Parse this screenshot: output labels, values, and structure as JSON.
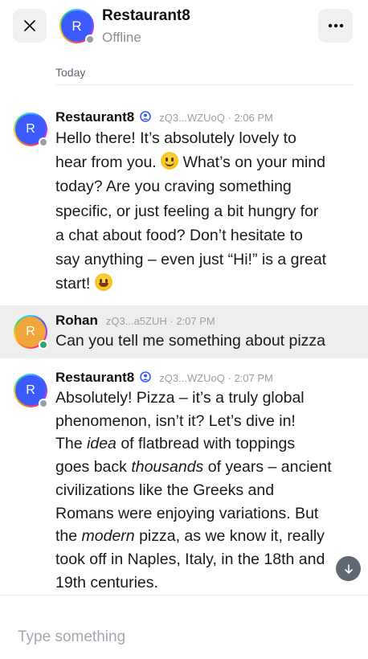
{
  "header": {
    "name": "Restaurant8",
    "status": "Offline",
    "avatar_letter": "R"
  },
  "day_label": "Today",
  "messages": [
    {
      "sender": "Restaurant8",
      "verified": true,
      "address": "zQ3...WZUoQ",
      "time": "2:06 PM",
      "avatar_letter": "R",
      "lines": [
        "Hello there! It’s absolutely lovely to",
        "hear from you.",
        "What’s on your mind",
        "today? Are you craving something",
        "specific, or just feeling a bit hungry for",
        "a chat about food? Don’t hesitate to",
        "say anything – even just “Hi!” is a great",
        "start!"
      ]
    },
    {
      "sender": "Rohan",
      "verified": false,
      "address": "zQ3...a5ZUH",
      "time": "2:07 PM",
      "avatar_letter": "R",
      "lines": [
        "Can you tell me something about pizza"
      ]
    },
    {
      "sender": "Restaurant8",
      "verified": true,
      "address": "zQ3...WZUoQ",
      "time": "2:07 PM",
      "avatar_letter": "R",
      "lines": [
        "Absolutely! Pizza – it’s a truly global",
        "phenomenon, isn’t it? Let’s dive in!",
        "The ",
        "idea",
        " of flatbread with toppings",
        "goes back ",
        "thousands",
        " of years – ancient",
        "civilizations like the Greeks and",
        "Romans were enjoying variations. But",
        "the ",
        "modern",
        " pizza, as we know it, really",
        "took off in Naples, Italy, in the 18th and",
        "19th centuries."
      ]
    }
  ],
  "composer": {
    "placeholder": "Type something"
  },
  "colors": {
    "bot_avatar_fill": "#3b5bff",
    "user_avatar_fill": "#f0a63a",
    "offline_dot": "#9aa0a8",
    "online_dot": "#2fa56b",
    "highlight_row": "#eeeeef"
  }
}
